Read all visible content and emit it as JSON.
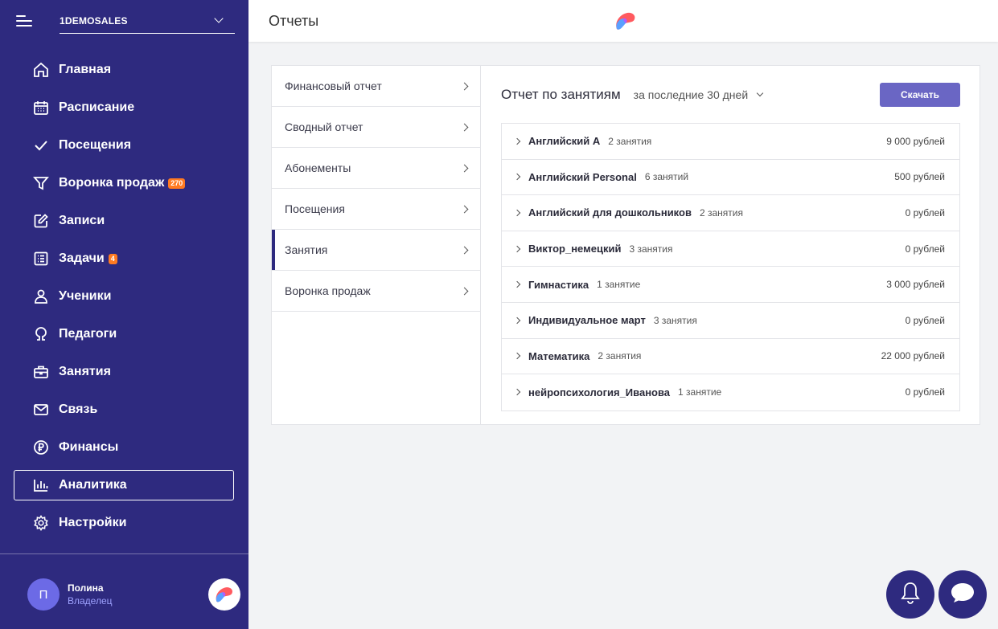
{
  "sidebar": {
    "org_name": "1DEMOSALES",
    "items": [
      {
        "label": "Главная",
        "icon": "home-icon"
      },
      {
        "label": "Расписание",
        "icon": "calendar-icon"
      },
      {
        "label": "Посещения",
        "icon": "check-icon"
      },
      {
        "label": "Воронка продаж",
        "icon": "funnel-icon",
        "badge": "270"
      },
      {
        "label": "Записи",
        "icon": "edit-icon"
      },
      {
        "label": "Задачи",
        "icon": "tasks-icon",
        "badge": "4"
      },
      {
        "label": "Ученики",
        "icon": "user-icon"
      },
      {
        "label": "Педагоги",
        "icon": "teacher-icon"
      },
      {
        "label": "Занятия",
        "icon": "briefcase-icon"
      },
      {
        "label": "Связь",
        "icon": "mail-icon"
      },
      {
        "label": "Финансы",
        "icon": "ruble-icon"
      },
      {
        "label": "Аналитика",
        "icon": "chart-icon",
        "active": true
      },
      {
        "label": "Настройки",
        "icon": "gear-icon"
      }
    ],
    "user": {
      "initial": "П",
      "name": "Полина",
      "role": "Владелец"
    }
  },
  "header": {
    "title": "Отчеты"
  },
  "reports_menu": [
    {
      "label": "Финансовый отчет"
    },
    {
      "label": "Сводный отчет"
    },
    {
      "label": "Абонементы"
    },
    {
      "label": "Посещения"
    },
    {
      "label": "Занятия",
      "active": true
    },
    {
      "label": "Воронка продаж"
    }
  ],
  "report": {
    "title": "Отчет по занятиям",
    "period": "за последние 30 дней",
    "download_label": "Скачать",
    "rows": [
      {
        "name": "Английский A",
        "count": "2 занятия",
        "sum": "9 000 рублей"
      },
      {
        "name": "Английский Personal",
        "count": "6 занятий",
        "sum": "500 рублей"
      },
      {
        "name": "Английский для дошкольников",
        "count": "2 занятия",
        "sum": "0 рублей"
      },
      {
        "name": "Виктор_немецкий",
        "count": "3 занятия",
        "sum": "0 рублей"
      },
      {
        "name": "Гимнастика",
        "count": "1 занятие",
        "sum": "3 000 рублей"
      },
      {
        "name": "Индивидуальное март",
        "count": "3 занятия",
        "sum": "0 рублей"
      },
      {
        "name": "Математика",
        "count": "2 занятия",
        "sum": "22 000 рублей"
      },
      {
        "name": "нейропсихология_Иванова",
        "count": "1 занятие",
        "sum": "0 рублей"
      }
    ]
  },
  "colors": {
    "sidebar_bg": "#2e2a7f",
    "accent_button": "#6a66c4",
    "badge": "#ff7a21"
  }
}
